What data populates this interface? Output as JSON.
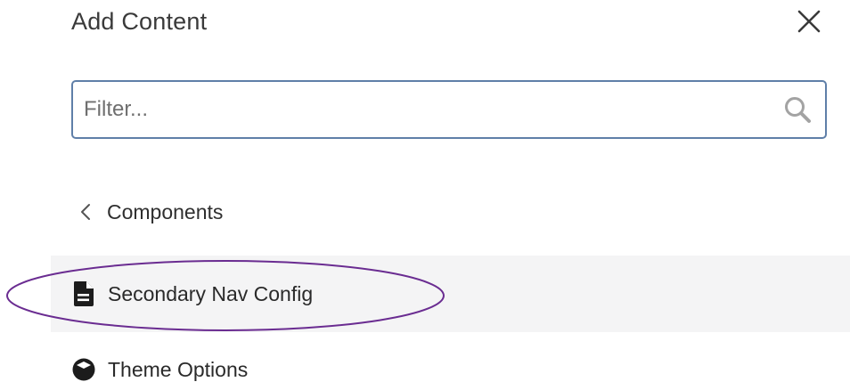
{
  "panel": {
    "title": "Add Content",
    "close_icon": "close-icon"
  },
  "search": {
    "placeholder": "Filter...",
    "value": "",
    "icon": "search-icon"
  },
  "breadcrumb": {
    "back_label": "Components",
    "icon": "chevron-left-icon"
  },
  "items": [
    {
      "label": "Secondary Nav Config",
      "icon": "document-icon",
      "highlighted": true
    },
    {
      "label": "Theme Options",
      "icon": "cube-icon",
      "highlighted": false
    }
  ],
  "colors": {
    "search_border": "#5f7fa8",
    "highlight_bg": "#f4f4f5",
    "annotation_ellipse": "#6a2c91"
  }
}
